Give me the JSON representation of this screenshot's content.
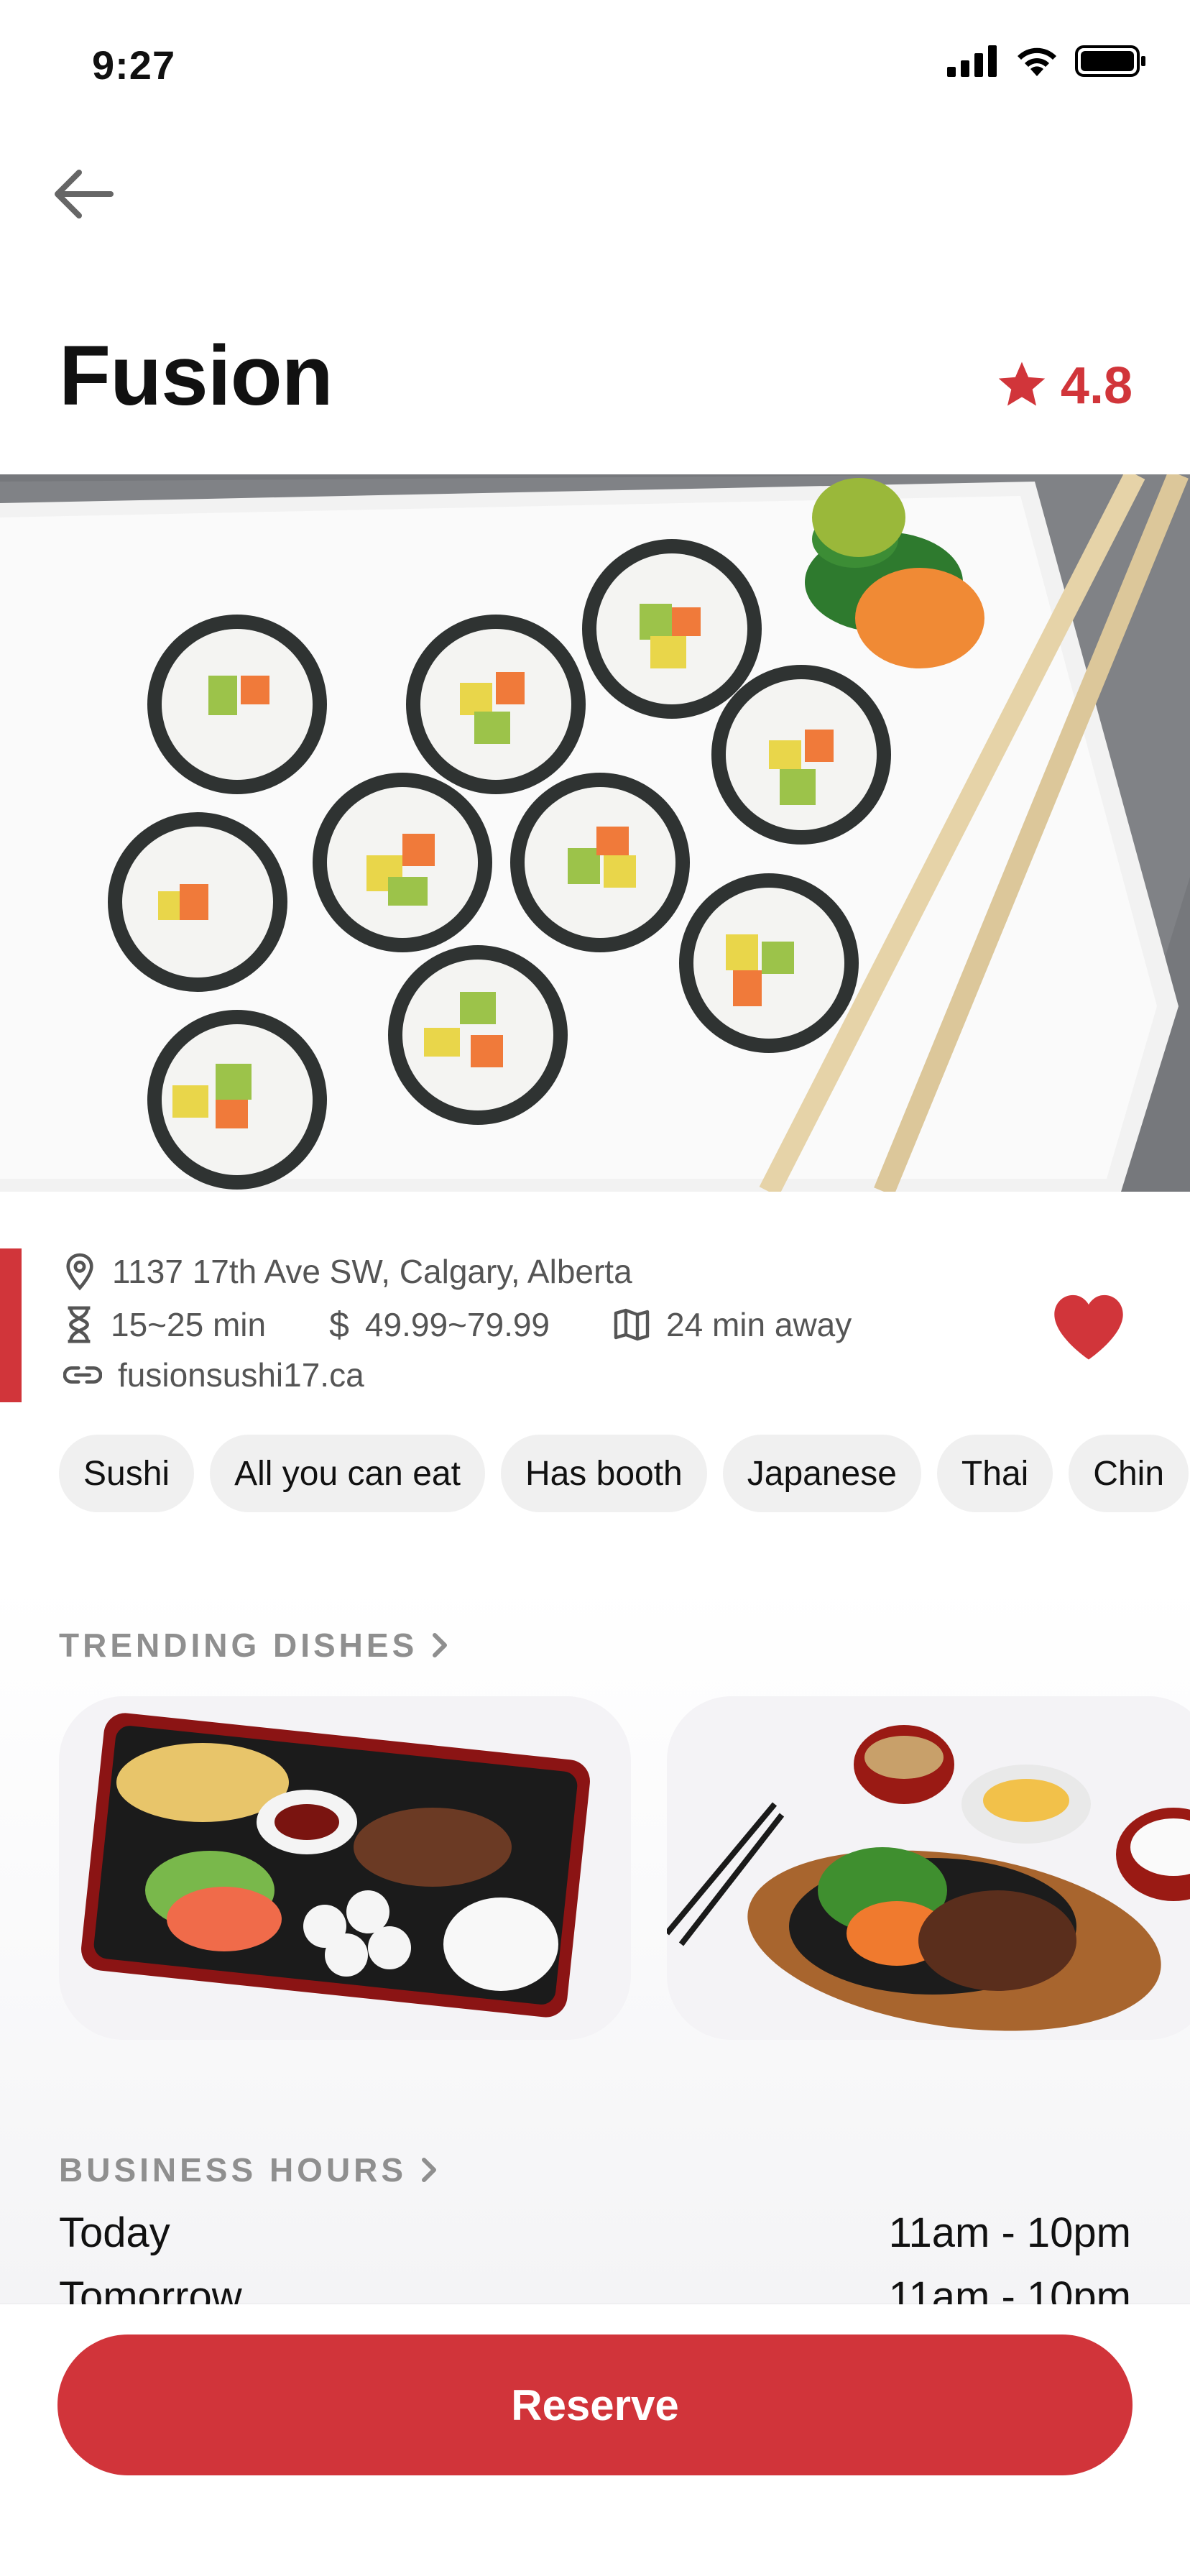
{
  "status_bar": {
    "time": "9:27"
  },
  "restaurant": {
    "name": "Fusion",
    "rating": "4.8",
    "address": "1137 17th Ave SW, Calgary, Alberta",
    "wait_time": "15~25 min",
    "price_range": "49.99~79.99",
    "distance": "24 min away",
    "website": "fusionsushi17.ca"
  },
  "tags": [
    "Sushi",
    "All you can eat",
    "Has booth",
    "Japanese",
    "Thai",
    "Chin"
  ],
  "sections": {
    "trending_title": "TRENDING DISHES",
    "hours_title": "BUSINESS HOURS"
  },
  "hours": [
    {
      "day": "Today",
      "time": "11am - 10pm"
    },
    {
      "day": "Tomorrow",
      "time": "11am - 10pm"
    }
  ],
  "actions": {
    "reserve_label": "Reserve"
  },
  "colors": {
    "accent": "#D1353A",
    "muted_text": "#555555",
    "chip_bg": "#F0F0F0"
  }
}
